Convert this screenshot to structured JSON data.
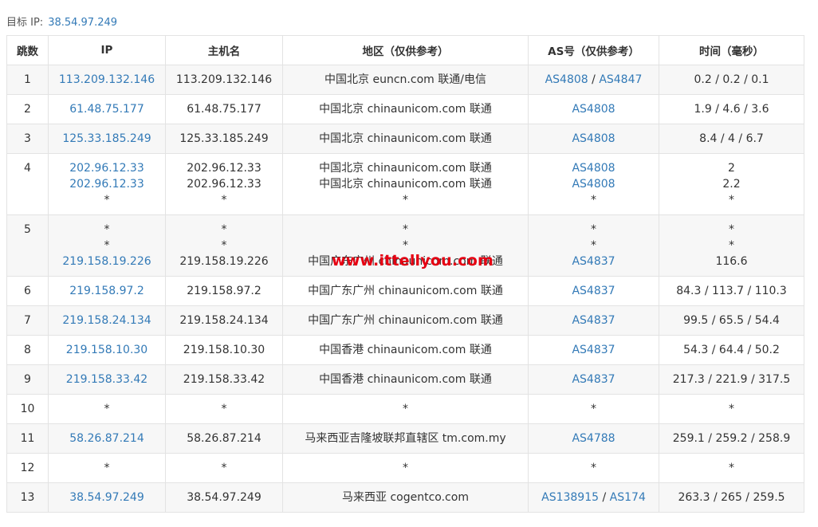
{
  "target": {
    "label": "目标 IP:",
    "ip": "38.54.97.249"
  },
  "headers": [
    "跳数",
    "IP",
    "主机名",
    "地区（仅供参考）",
    "AS号（仅供参考）",
    "时间（毫秒）"
  ],
  "rows": [
    {
      "hop": "1",
      "ips": [
        "113.209.132.146"
      ],
      "hosts": [
        "113.209.132.146"
      ],
      "regions": [
        "中国北京 euncn.com 联通/电信"
      ],
      "as": [
        [
          "AS4808",
          "AS4847"
        ]
      ],
      "times": [
        "0.2 / 0.2 / 0.1"
      ]
    },
    {
      "hop": "2",
      "ips": [
        "61.48.75.177"
      ],
      "hosts": [
        "61.48.75.177"
      ],
      "regions": [
        "中国北京 chinaunicom.com 联通"
      ],
      "as": [
        [
          "AS4808"
        ]
      ],
      "times": [
        "1.9 / 4.6 / 3.6"
      ]
    },
    {
      "hop": "3",
      "ips": [
        "125.33.185.249"
      ],
      "hosts": [
        "125.33.185.249"
      ],
      "regions": [
        "中国北京 chinaunicom.com 联通"
      ],
      "as": [
        [
          "AS4808"
        ]
      ],
      "times": [
        "8.4 / 4 / 6.7"
      ]
    },
    {
      "hop": "4",
      "ips": [
        "202.96.12.33",
        "202.96.12.33",
        "*"
      ],
      "hosts": [
        "202.96.12.33",
        "202.96.12.33",
        "*"
      ],
      "regions": [
        "中国北京 chinaunicom.com 联通",
        "中国北京 chinaunicom.com 联通",
        "*"
      ],
      "as": [
        [
          "AS4808"
        ],
        [
          "AS4808"
        ],
        [
          "*"
        ]
      ],
      "times": [
        "2",
        "2.2",
        "*"
      ]
    },
    {
      "hop": "5",
      "ips": [
        "*",
        "*",
        "219.158.19.226"
      ],
      "hosts": [
        "*",
        "*",
        "219.158.19.226"
      ],
      "regions": [
        "*",
        "*",
        "中国广东广州 chinaunicom.com 联通"
      ],
      "as": [
        [
          "*"
        ],
        [
          "*"
        ],
        [
          "AS4837"
        ]
      ],
      "times": [
        "*",
        "*",
        "116.6"
      ]
    },
    {
      "hop": "6",
      "ips": [
        "219.158.97.2"
      ],
      "hosts": [
        "219.158.97.2"
      ],
      "regions": [
        "中国广东广州 chinaunicom.com 联通"
      ],
      "as": [
        [
          "AS4837"
        ]
      ],
      "times": [
        "84.3 / 113.7 / 110.3"
      ]
    },
    {
      "hop": "7",
      "ips": [
        "219.158.24.134"
      ],
      "hosts": [
        "219.158.24.134"
      ],
      "regions": [
        "中国广东广州 chinaunicom.com 联通"
      ],
      "as": [
        [
          "AS4837"
        ]
      ],
      "times": [
        "99.5 / 65.5 / 54.4"
      ]
    },
    {
      "hop": "8",
      "ips": [
        "219.158.10.30"
      ],
      "hosts": [
        "219.158.10.30"
      ],
      "regions": [
        "中国香港 chinaunicom.com 联通"
      ],
      "as": [
        [
          "AS4837"
        ]
      ],
      "times": [
        "54.3 / 64.4 / 50.2"
      ]
    },
    {
      "hop": "9",
      "ips": [
        "219.158.33.42"
      ],
      "hosts": [
        "219.158.33.42"
      ],
      "regions": [
        "中国香港 chinaunicom.com 联通"
      ],
      "as": [
        [
          "AS4837"
        ]
      ],
      "times": [
        "217.3 / 221.9 / 317.5"
      ]
    },
    {
      "hop": "10",
      "ips": [
        "*"
      ],
      "hosts": [
        "*"
      ],
      "regions": [
        "*"
      ],
      "as": [
        [
          "*"
        ]
      ],
      "times": [
        "*"
      ]
    },
    {
      "hop": "11",
      "ips": [
        "58.26.87.214"
      ],
      "hosts": [
        "58.26.87.214"
      ],
      "regions": [
        "马来西亚吉隆坡联邦直辖区 tm.com.my"
      ],
      "as": [
        [
          "AS4788"
        ]
      ],
      "times": [
        "259.1 / 259.2 / 258.9"
      ]
    },
    {
      "hop": "12",
      "ips": [
        "*"
      ],
      "hosts": [
        "*"
      ],
      "regions": [
        "*"
      ],
      "as": [
        [
          "*"
        ]
      ],
      "times": [
        "*"
      ]
    },
    {
      "hop": "13",
      "ips": [
        "38.54.97.249"
      ],
      "hosts": [
        "38.54.97.249"
      ],
      "regions": [
        "马来西亚 cogentco.com"
      ],
      "as": [
        [
          "AS138915",
          "AS174"
        ]
      ],
      "times": [
        "263.3 / 265 / 259.5"
      ]
    }
  ],
  "watermark": "www.ittellyou.com",
  "colors": {
    "link": "#337ab7",
    "watermark": "#e60012",
    "stripe": "#f7f7f7",
    "border": "#e3e3e3"
  }
}
